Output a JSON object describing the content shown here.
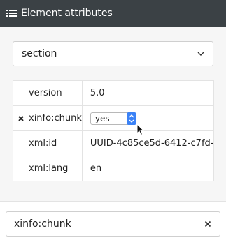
{
  "header": {
    "title": "Element attributes",
    "icon": "list-icon"
  },
  "element_select": {
    "value": "section",
    "icon": "chevron-down-icon"
  },
  "attributes": [
    {
      "name": "version",
      "value": "5.0",
      "removable": false
    },
    {
      "name": "xinfo:chunk",
      "value": "yes",
      "removable": true,
      "control": "select"
    },
    {
      "name": "xml:id",
      "value": "UUID-4c85ce5d-6412-c7fd-",
      "removable": false
    },
    {
      "name": "xml:lang",
      "value": "en",
      "removable": false
    }
  ],
  "filter": {
    "value": "xinfo:chunk",
    "clear_icon": "close-icon"
  },
  "colors": {
    "header_bg": "#3b4145",
    "accent": "#3b82f6"
  }
}
